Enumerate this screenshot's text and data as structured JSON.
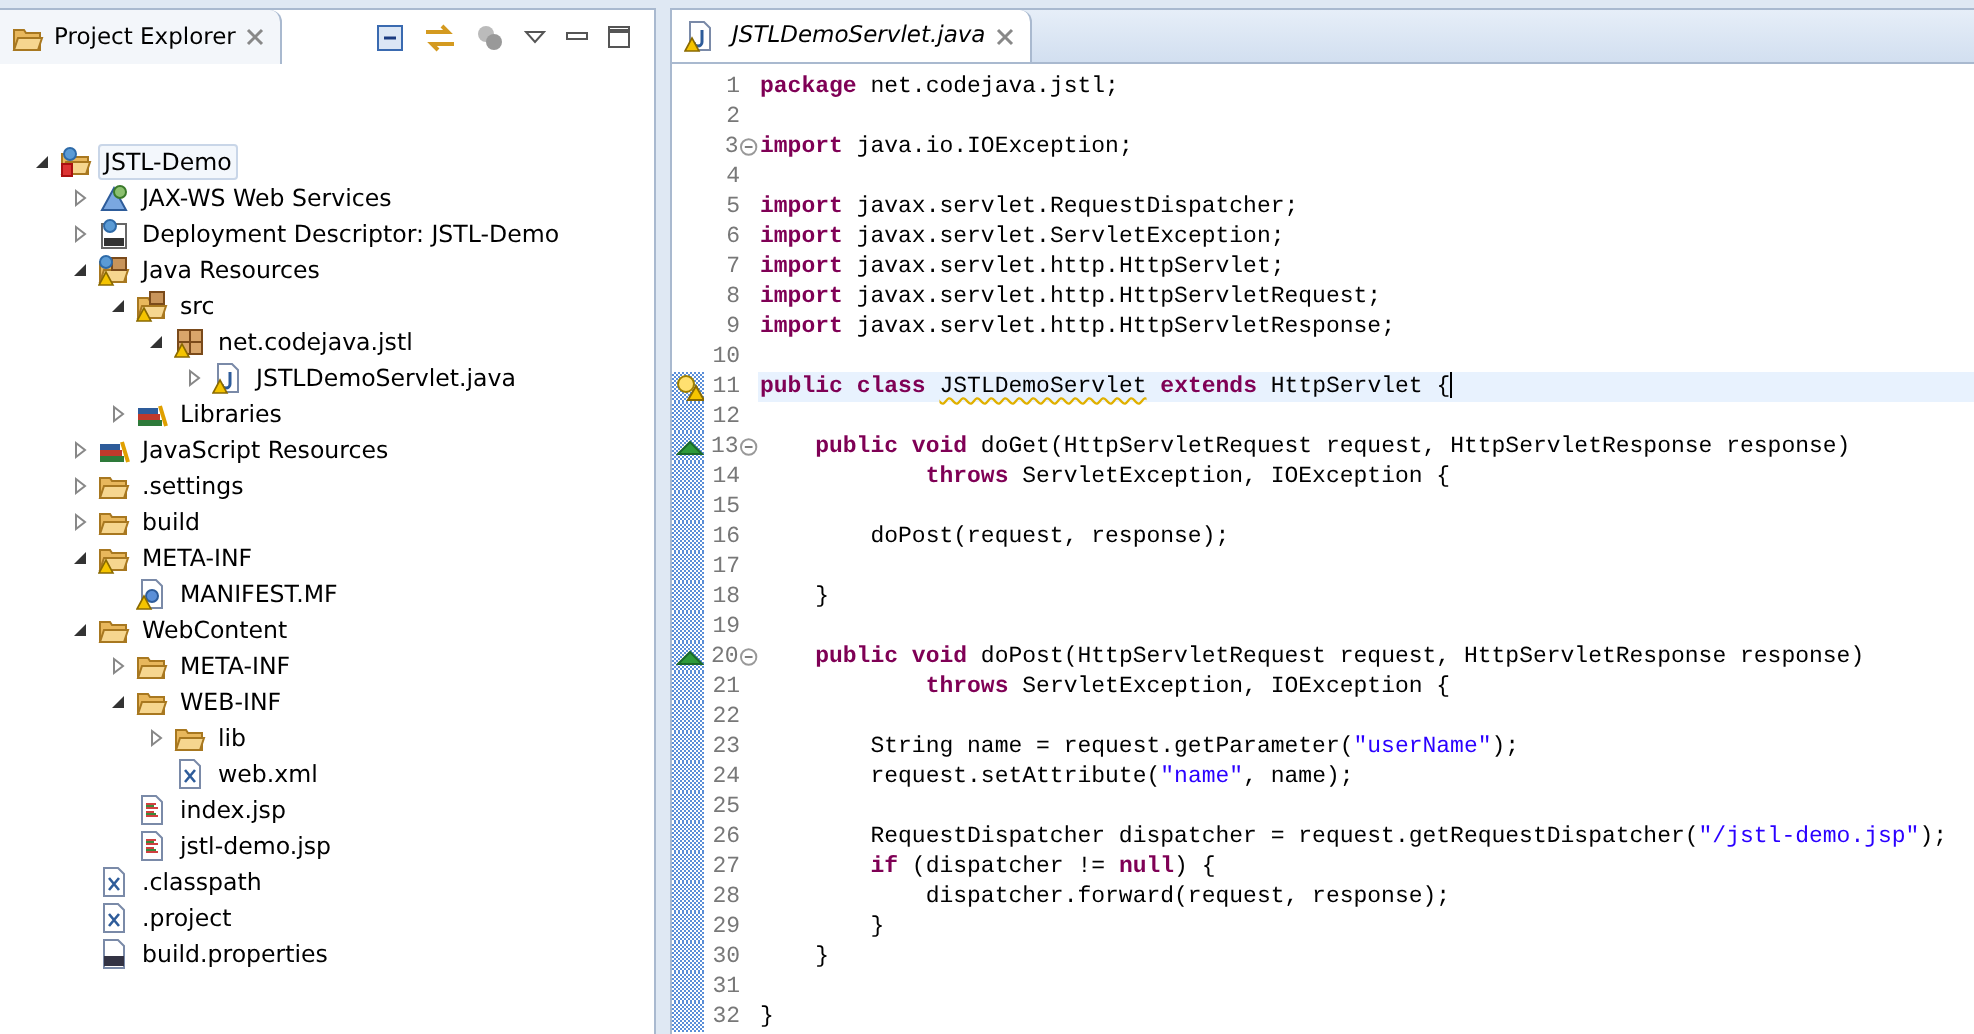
{
  "explorer": {
    "title": "Project Explorer",
    "tree": [
      {
        "label": "JSTL-Demo",
        "kind": "project",
        "expanded": true,
        "selected": true,
        "children": [
          {
            "label": "JAX-WS Web Services",
            "kind": "webservices",
            "expanded": false,
            "selected": false
          },
          {
            "label": "Deployment Descriptor: JSTL-Demo",
            "kind": "descriptor",
            "expanded": false,
            "selected": false
          },
          {
            "label": "Java Resources",
            "kind": "javares",
            "warning": true,
            "expanded": true,
            "selected": false,
            "children": [
              {
                "label": "src",
                "kind": "srcfolder",
                "warning": true,
                "expanded": true,
                "selected": false,
                "children": [
                  {
                    "label": "net.codejava.jstl",
                    "kind": "package",
                    "warning": true,
                    "expanded": true,
                    "selected": false,
                    "children": [
                      {
                        "label": "JSTLDemoServlet.java",
                        "kind": "java",
                        "warning": true,
                        "expanded": false,
                        "selected": false
                      }
                    ]
                  }
                ]
              },
              {
                "label": "Libraries",
                "kind": "libraries",
                "expanded": false,
                "selected": false
              }
            ]
          },
          {
            "label": "JavaScript Resources",
            "kind": "libraries",
            "expanded": false,
            "selected": false
          },
          {
            "label": ".settings",
            "kind": "folder",
            "expanded": false,
            "selected": false
          },
          {
            "label": "build",
            "kind": "folder",
            "expanded": false,
            "selected": false
          },
          {
            "label": "META-INF",
            "kind": "folder",
            "warning": true,
            "expanded": true,
            "selected": false,
            "children": [
              {
                "label": "MANIFEST.MF",
                "kind": "manifest",
                "warning": true,
                "selected": false
              }
            ]
          },
          {
            "label": "WebContent",
            "kind": "folder",
            "expanded": true,
            "selected": false,
            "children": [
              {
                "label": "META-INF",
                "kind": "folder",
                "expanded": false,
                "selected": false
              },
              {
                "label": "WEB-INF",
                "kind": "folder",
                "expanded": true,
                "selected": false,
                "children": [
                  {
                    "label": "lib",
                    "kind": "folder",
                    "expanded": false,
                    "selected": false
                  },
                  {
                    "label": "web.xml",
                    "kind": "xml",
                    "selected": false
                  }
                ]
              },
              {
                "label": "index.jsp",
                "kind": "jsp",
                "selected": false
              },
              {
                "label": "jstl-demo.jsp",
                "kind": "jsp",
                "selected": false
              }
            ]
          },
          {
            "label": ".classpath",
            "kind": "xml",
            "selected": false
          },
          {
            "label": ".project",
            "kind": "xml",
            "selected": false
          },
          {
            "label": "build.properties",
            "kind": "properties",
            "selected": false
          }
        ]
      }
    ]
  },
  "editor": {
    "tab": {
      "title": "JSTLDemoServlet.java",
      "warning": true
    },
    "lines": [
      {
        "number": "1",
        "segments": [
          {
            "kind": "kw",
            "text": "package"
          },
          {
            "kind": "plain",
            "text": " net.codejava.jstl;"
          }
        ]
      },
      {
        "number": "2"
      },
      {
        "number": "3",
        "fold": true,
        "segments": [
          {
            "kind": "kw",
            "text": "import"
          },
          {
            "kind": "plain",
            "text": " java.io.IOException;"
          }
        ]
      },
      {
        "number": "4"
      },
      {
        "number": "5",
        "segments": [
          {
            "kind": "kw",
            "text": "import"
          },
          {
            "kind": "plain",
            "text": " javax.servlet.RequestDispatcher;"
          }
        ]
      },
      {
        "number": "6",
        "segments": [
          {
            "kind": "kw",
            "text": "import"
          },
          {
            "kind": "plain",
            "text": " javax.servlet.ServletException;"
          }
        ]
      },
      {
        "number": "7",
        "segments": [
          {
            "kind": "kw",
            "text": "import"
          },
          {
            "kind": "plain",
            "text": " javax.servlet.http.HttpServlet;"
          }
        ]
      },
      {
        "number": "8",
        "segments": [
          {
            "kind": "kw",
            "text": "import"
          },
          {
            "kind": "plain",
            "text": " javax.servlet.http.HttpServletRequest;"
          }
        ]
      },
      {
        "number": "9",
        "segments": [
          {
            "kind": "kw",
            "text": "import"
          },
          {
            "kind": "plain",
            "text": " javax.servlet.http.HttpServletResponse;"
          }
        ]
      },
      {
        "number": "10"
      },
      {
        "number": "11",
        "current": true,
        "changed": true,
        "kind": "warning",
        "segments": [
          {
            "kind": "kw",
            "text": "public "
          },
          {
            "kind": "kw",
            "text": "class "
          },
          {
            "kind": "warn",
            "text": "JSTLDemoServlet"
          },
          {
            "kind": "kw",
            "text": " extends"
          },
          {
            "kind": "plain",
            "text": " HttpServlet {"
          }
        ]
      },
      {
        "number": "12",
        "changed": true
      },
      {
        "number": "13",
        "changed": true,
        "fold": true,
        "kind": "override",
        "segments": [
          {
            "kind": "kw",
            "text": "    public "
          },
          {
            "kind": "kw",
            "text": "void"
          },
          {
            "kind": "plain",
            "text": " doGet(HttpServletRequest request, HttpServletResponse response)"
          }
        ]
      },
      {
        "number": "14",
        "changed": true,
        "segments": [
          {
            "kind": "kw",
            "text": "            throws"
          },
          {
            "kind": "plain",
            "text": " ServletException, IOException {"
          }
        ]
      },
      {
        "number": "15",
        "changed": true
      },
      {
        "number": "16",
        "changed": true,
        "segments": [
          {
            "kind": "plain",
            "text": "        doPost(request, response);"
          }
        ]
      },
      {
        "number": "17",
        "changed": true
      },
      {
        "number": "18",
        "changed": true,
        "segments": [
          {
            "kind": "plain",
            "text": "    }"
          }
        ]
      },
      {
        "number": "19",
        "changed": true
      },
      {
        "number": "20",
        "changed": true,
        "fold": true,
        "kind": "override",
        "segments": [
          {
            "kind": "kw",
            "text": "    public "
          },
          {
            "kind": "kw",
            "text": "void"
          },
          {
            "kind": "plain",
            "text": " doPost(HttpServletRequest request, HttpServletResponse response)"
          }
        ]
      },
      {
        "number": "21",
        "changed": true,
        "segments": [
          {
            "kind": "kw",
            "text": "            throws"
          },
          {
            "kind": "plain",
            "text": " ServletException, IOException {"
          }
        ]
      },
      {
        "number": "22",
        "changed": true
      },
      {
        "number": "23",
        "changed": true,
        "segments": [
          {
            "kind": "plain",
            "text": "        String name = request.getParameter("
          },
          {
            "kind": "str",
            "text": "\"userName\""
          },
          {
            "kind": "plain",
            "text": ");"
          }
        ]
      },
      {
        "number": "24",
        "changed": true,
        "segments": [
          {
            "kind": "plain",
            "text": "        request.setAttribute("
          },
          {
            "kind": "str",
            "text": "\"name\""
          },
          {
            "kind": "plain",
            "text": ", name);"
          }
        ]
      },
      {
        "number": "25",
        "changed": true
      },
      {
        "number": "26",
        "changed": true,
        "segments": [
          {
            "kind": "plain",
            "text": "        RequestDispatcher dispatcher = request.getRequestDispatcher("
          },
          {
            "kind": "str",
            "text": "\"/jstl-demo.jsp\""
          },
          {
            "kind": "plain",
            "text": ");"
          }
        ]
      },
      {
        "number": "27",
        "changed": true,
        "segments": [
          {
            "kind": "kw",
            "text": "        if"
          },
          {
            "kind": "plain",
            "text": " (dispatcher != "
          },
          {
            "kind": "kw",
            "text": "null"
          },
          {
            "kind": "plain",
            "text": ") {"
          }
        ]
      },
      {
        "number": "28",
        "changed": true,
        "segments": [
          {
            "kind": "plain",
            "text": "            dispatcher.forward(request, response);"
          }
        ]
      },
      {
        "number": "29",
        "changed": true,
        "segments": [
          {
            "kind": "plain",
            "text": "        }"
          }
        ]
      },
      {
        "number": "30",
        "changed": true,
        "segments": [
          {
            "kind": "plain",
            "text": "    }"
          }
        ]
      },
      {
        "number": "31",
        "changed": true
      },
      {
        "number": "32",
        "changed": true,
        "segments": [
          {
            "kind": "plain",
            "text": "}"
          }
        ]
      }
    ]
  }
}
